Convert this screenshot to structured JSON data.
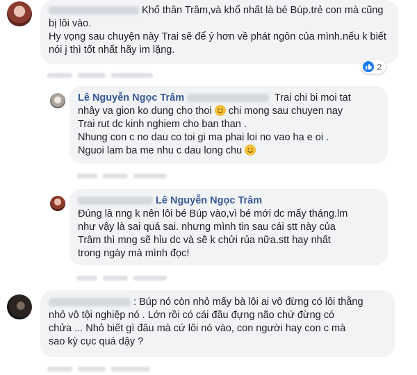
{
  "comments": [
    {
      "id": "c1",
      "text": "Khổ thân Trâm,và khổ nhất là bé Búp.trẻ con mà cũng bị lôi vào.\nHy vọng sau chuyện này Trai sẽ để ý hơn về phát ngôn của mình.nếu k biết nói j thì tốt nhất hãy im lặng.",
      "reaction_count": "2"
    },
    {
      "id": "c2",
      "author": "Lê Nguyễn Ngọc Trâm",
      "line1": "Trai chi bi moi tat",
      "line2a": "nhây va gion ko dung cho thoi",
      "line2b": "chi mong sau chuyen nay",
      "line3": "Trai rut dc kinh nghiem cho ban than .",
      "line4": "Nhung con c no dau co toi gi ma phai loi no vao ha e oi .",
      "line5": "Nguoi lam ba me nhu c dau long chu"
    },
    {
      "id": "c3",
      "mention": "Lê Nguyễn Ngọc Trâm",
      "text": "Đúng là nng k nên lôi bé Búp vào,vì bé mới dc mấy tháng.lm\nnhư vậy là sai quá sai. nhưng mình tin sau cái stt này của\nTrâm thì mng sẽ hỉu dc và sẽ k chửi rủa nữa.stt hay nhất\ntrong ngày mà mình đọc!"
    },
    {
      "id": "c4",
      "text_first": ": Búp nó còn nhỏ mấy bà lôi ai vô đừng có lôi thằng",
      "text_rest": "nhỏ vô tội nghiệp nó . Lớn rồi có cái đầu đựng não chứ đừng có\nchửa ... Nhỏ biết gì đâu mà cứ lôi nó vào, con người hay con c mà\nsao kỳ cục quá dậy ?"
    }
  ],
  "icons": {
    "like": "like-icon",
    "smile": "smile-emoji-icon"
  },
  "colors": {
    "bubble": "#f2f3f5",
    "author": "#385898",
    "like_blue": "#1877f2"
  }
}
